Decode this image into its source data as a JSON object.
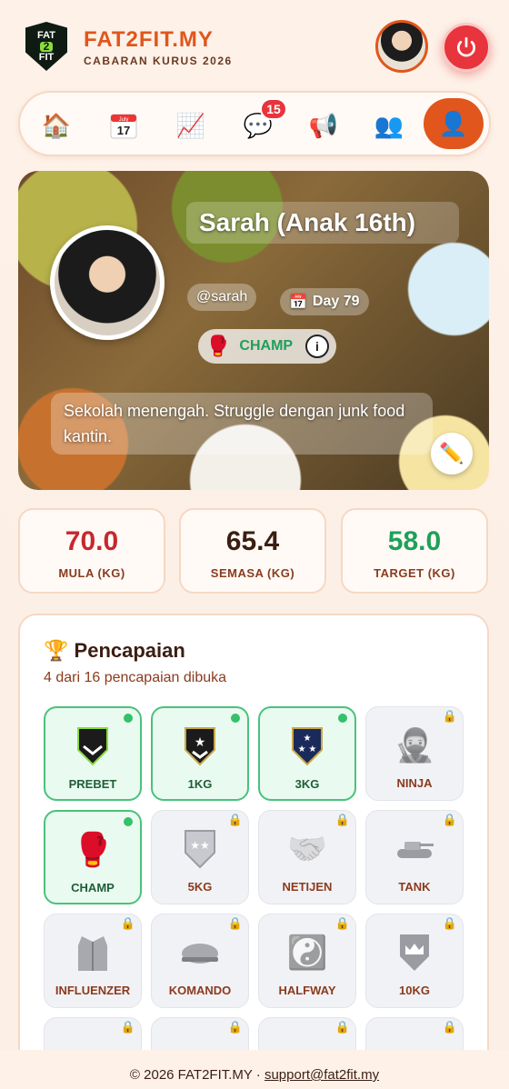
{
  "brand": {
    "logo_top": "FAT",
    "logo_mid": "2",
    "logo_bottom": "FIT",
    "title": "FAT2FIT.MY",
    "subtitle": "CABARAN KURUS 2026"
  },
  "nav": {
    "notifications": "15",
    "calendar_month": "July",
    "calendar_day": "17"
  },
  "profile": {
    "name": "Sarah (Anak 16th)",
    "username": "@sarah",
    "day": "Day 79",
    "rank": "CHAMP",
    "info_icon": "i",
    "bio": "Sekolah menengah. Struggle dengan junk food kantin."
  },
  "stats": [
    {
      "value": "70.0",
      "label": "MULA (KG)",
      "color": "#c6282e"
    },
    {
      "value": "65.4",
      "label": "SEMASA (KG)",
      "color": "#3b1e12"
    },
    {
      "value": "58.0",
      "label": "TARGET (KG)",
      "color": "#1ea05a"
    }
  ],
  "achievements": {
    "title": "Pencapaian",
    "subtitle": "4 dari 16 pencapaian dibuka",
    "items": [
      {
        "label": "PREBET",
        "unlocked": true,
        "icon": "chevron-shield-icon"
      },
      {
        "label": "1KG",
        "unlocked": true,
        "icon": "star-shield-icon"
      },
      {
        "label": "3KG",
        "unlocked": true,
        "icon": "three-star-shield-icon"
      },
      {
        "label": "NINJA",
        "unlocked": false,
        "icon": "ninja-icon"
      },
      {
        "label": "CHAMP",
        "unlocked": true,
        "icon": "boxing-glove-icon"
      },
      {
        "label": "5KG",
        "unlocked": false,
        "icon": "stars-shield-icon"
      },
      {
        "label": "NETIJEN",
        "unlocked": false,
        "icon": "handshake-icon"
      },
      {
        "label": "TANK",
        "unlocked": false,
        "icon": "tank-icon"
      },
      {
        "label": "INFLUENZER",
        "unlocked": false,
        "icon": "suit-icon"
      },
      {
        "label": "KOMANDO",
        "unlocked": false,
        "icon": "beret-icon"
      },
      {
        "label": "HALFWAY",
        "unlocked": false,
        "icon": "yin-yang-icon"
      },
      {
        "label": "10KG",
        "unlocked": false,
        "icon": "crown-shield-icon"
      }
    ]
  },
  "footer": {
    "copyright": "© 2026 FAT2FIT.MY · ",
    "email": "support@fat2fit.my"
  }
}
